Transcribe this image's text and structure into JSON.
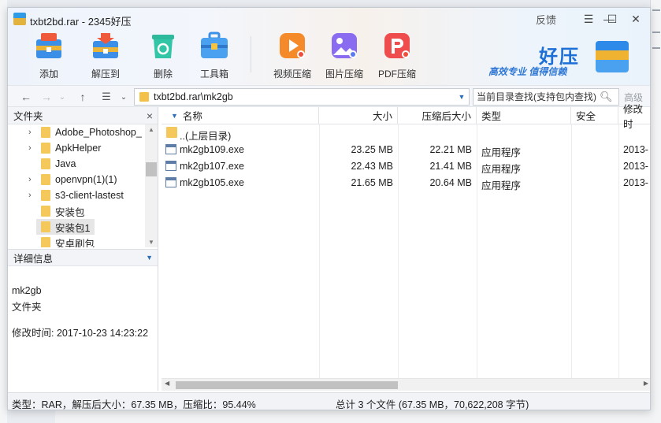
{
  "window": {
    "title": "txbt2bd.rar - 2345好压",
    "controls": {
      "feedback": "反馈",
      "menu": "☰",
      "minimize": "—",
      "maximize": "☐",
      "close": "✕"
    }
  },
  "toolbar": {
    "add": "添加",
    "extract": "解压到",
    "delete": "删除",
    "toolbox": "工具箱",
    "video": "视频压缩",
    "image": "图片压缩",
    "pdf": "PDF压缩"
  },
  "brand": {
    "name": "好压",
    "slogan": "高效专业 值得信赖"
  },
  "address": {
    "back": "←",
    "forward": "→",
    "up": "↑",
    "path": "txbt2bd.rar\\mk2gb",
    "search_placeholder": "当前目录查找(支持包内查找)",
    "advanced": "高级"
  },
  "folders_panel": {
    "title": "文件夹",
    "close": "×",
    "items": [
      {
        "name": "Adobe_Photoshop_",
        "expandable": true
      },
      {
        "name": "ApkHelper",
        "expandable": true
      },
      {
        "name": "Java",
        "expandable": false
      },
      {
        "name": "openvpn(1)(1)",
        "expandable": true
      },
      {
        "name": "s3-client-lastest",
        "expandable": true
      },
      {
        "name": "安装包",
        "expandable": false
      },
      {
        "name": "安装包1",
        "expandable": false,
        "selected": true
      },
      {
        "name": "安卓刷包",
        "expandable": false
      }
    ]
  },
  "details": {
    "title": "详细信息",
    "name": "mk2gb",
    "type": "文件夹",
    "modified": "修改时间:  2017-10-23 14:23:22"
  },
  "columns": [
    "名称",
    "大小",
    "压缩后大小",
    "类型",
    "安全",
    "修改时"
  ],
  "files": [
    {
      "name": "..(上层目录)",
      "size": "",
      "packed": "",
      "type": "",
      "modified": "",
      "up": true
    },
    {
      "name": "mk2gb109.exe",
      "size": "23.25 MB",
      "packed": "22.21 MB",
      "type": "应用程序",
      "modified": "2013-"
    },
    {
      "name": "mk2gb107.exe",
      "size": "22.43 MB",
      "packed": "21.41 MB",
      "type": "应用程序",
      "modified": "2013-"
    },
    {
      "name": "mk2gb105.exe",
      "size": "21.65 MB",
      "packed": "20.64 MB",
      "type": "应用程序",
      "modified": "2013-"
    }
  ],
  "status": {
    "left": "类型：RAR，解压后大小：67.35 MB，压缩比：95.44%",
    "right": "总计 3 个文件 (67.35 MB，70,622,208 字节)"
  },
  "colors": {
    "accent": "#1d6fd6",
    "folder": "#f4c85a"
  }
}
